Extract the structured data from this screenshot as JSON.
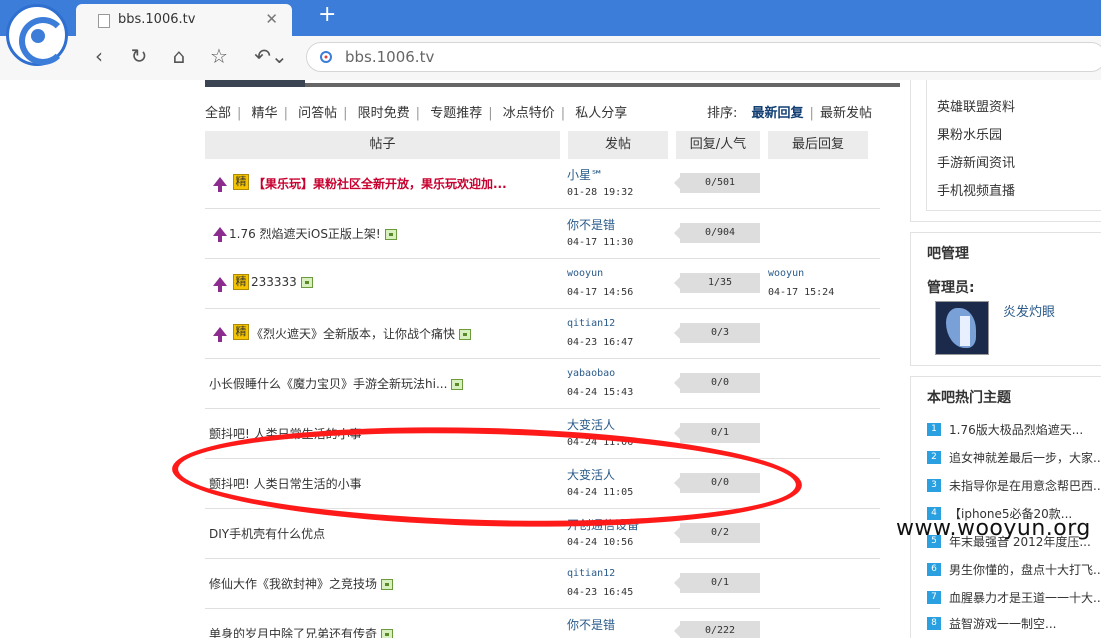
{
  "browser": {
    "tab_title": "bbs.1006.tv",
    "address": "bbs.1006.tv",
    "new_tab_symbol": "+",
    "close_symbol": "✕"
  },
  "forum": {
    "filters": [
      "全部",
      "精华",
      "问答帖",
      "限时免费",
      "专题推荐",
      "冰点特价",
      "私人分享"
    ],
    "sort_label": "排序:",
    "sort_options": [
      "最新回复",
      "最新发帖"
    ],
    "columns": [
      "帖子",
      "发帖",
      "回复/人气",
      "最后回复"
    ],
    "rows": [
      {
        "title": "【果乐玩】果粉社区全新开放，果乐玩欢迎加...",
        "author": "小星℠",
        "time": "01-28 19:32",
        "stat": "0/501",
        "last_user": "",
        "last_time": ""
      },
      {
        "title": "1.76 烈焰遮天iOS正版上架!",
        "author": "你不是错",
        "time": "04-17 11:30",
        "stat": "0/904",
        "last_user": "",
        "last_time": ""
      },
      {
        "title": "233333",
        "author": "wooyun",
        "time": "04-17 14:56",
        "stat": "1/35",
        "last_user": "wooyun",
        "last_time": "04-17 15:24"
      },
      {
        "title": "《烈火遮天》全新版本，让你战个痛快",
        "author": "qitian12",
        "time": "04-23 16:47",
        "stat": "0/3",
        "last_user": "",
        "last_time": ""
      },
      {
        "title": "小长假睡什么《魔力宝贝》手游全新玩法hi...",
        "author": "yabaobao",
        "time": "04-24 15:43",
        "stat": "0/0",
        "last_user": "",
        "last_time": ""
      },
      {
        "title": "颤抖吧! 人类日常生活的小事",
        "author": "大变活人",
        "time": "04-24 11:06",
        "stat": "0/1",
        "last_user": "",
        "last_time": ""
      },
      {
        "title": "颤抖吧! 人类日常生活的小事",
        "author": "大变活人",
        "time": "04-24 11:05",
        "stat": "0/0",
        "last_user": "",
        "last_time": ""
      },
      {
        "title": "DIY手机壳有什么优点",
        "author": "开创通信设备",
        "time": "04-24 10:56",
        "stat": "0/2",
        "last_user": "",
        "last_time": ""
      },
      {
        "title": "修仙大作《我欲封神》之竞技场",
        "author": "qitian12",
        "time": "04-23 16:45",
        "stat": "0/1",
        "last_user": "",
        "last_time": ""
      },
      {
        "title": "单身的岁月中除了兄弟还有传奇",
        "author": "你不是错",
        "time": "",
        "stat": "0/222",
        "last_user": "",
        "last_time": ""
      }
    ],
    "jing_label": "精"
  },
  "sidebar": {
    "links": [
      "英雄联盟资料",
      "果粉水乐园",
      "手游新闻资讯",
      "手机视频直播"
    ],
    "admin_title": "吧管理",
    "admin_label": "管理员:",
    "admin_name": "炎发灼眼",
    "hot_title": "本吧热门主题",
    "hot": [
      "1.76版大极品烈焰遮天...",
      "追女神就差最后一步，大家...",
      "未指导你是在用意念帮巴西...",
      "【iphone5必备20款...",
      "年末最强音 2012年度压...",
      "男生你懂的，盘点十大打飞...",
      "血腥暴力才是王道一一十大...",
      "益智游戏一一制空..."
    ]
  },
  "watermark": "www.wooyun.org"
}
